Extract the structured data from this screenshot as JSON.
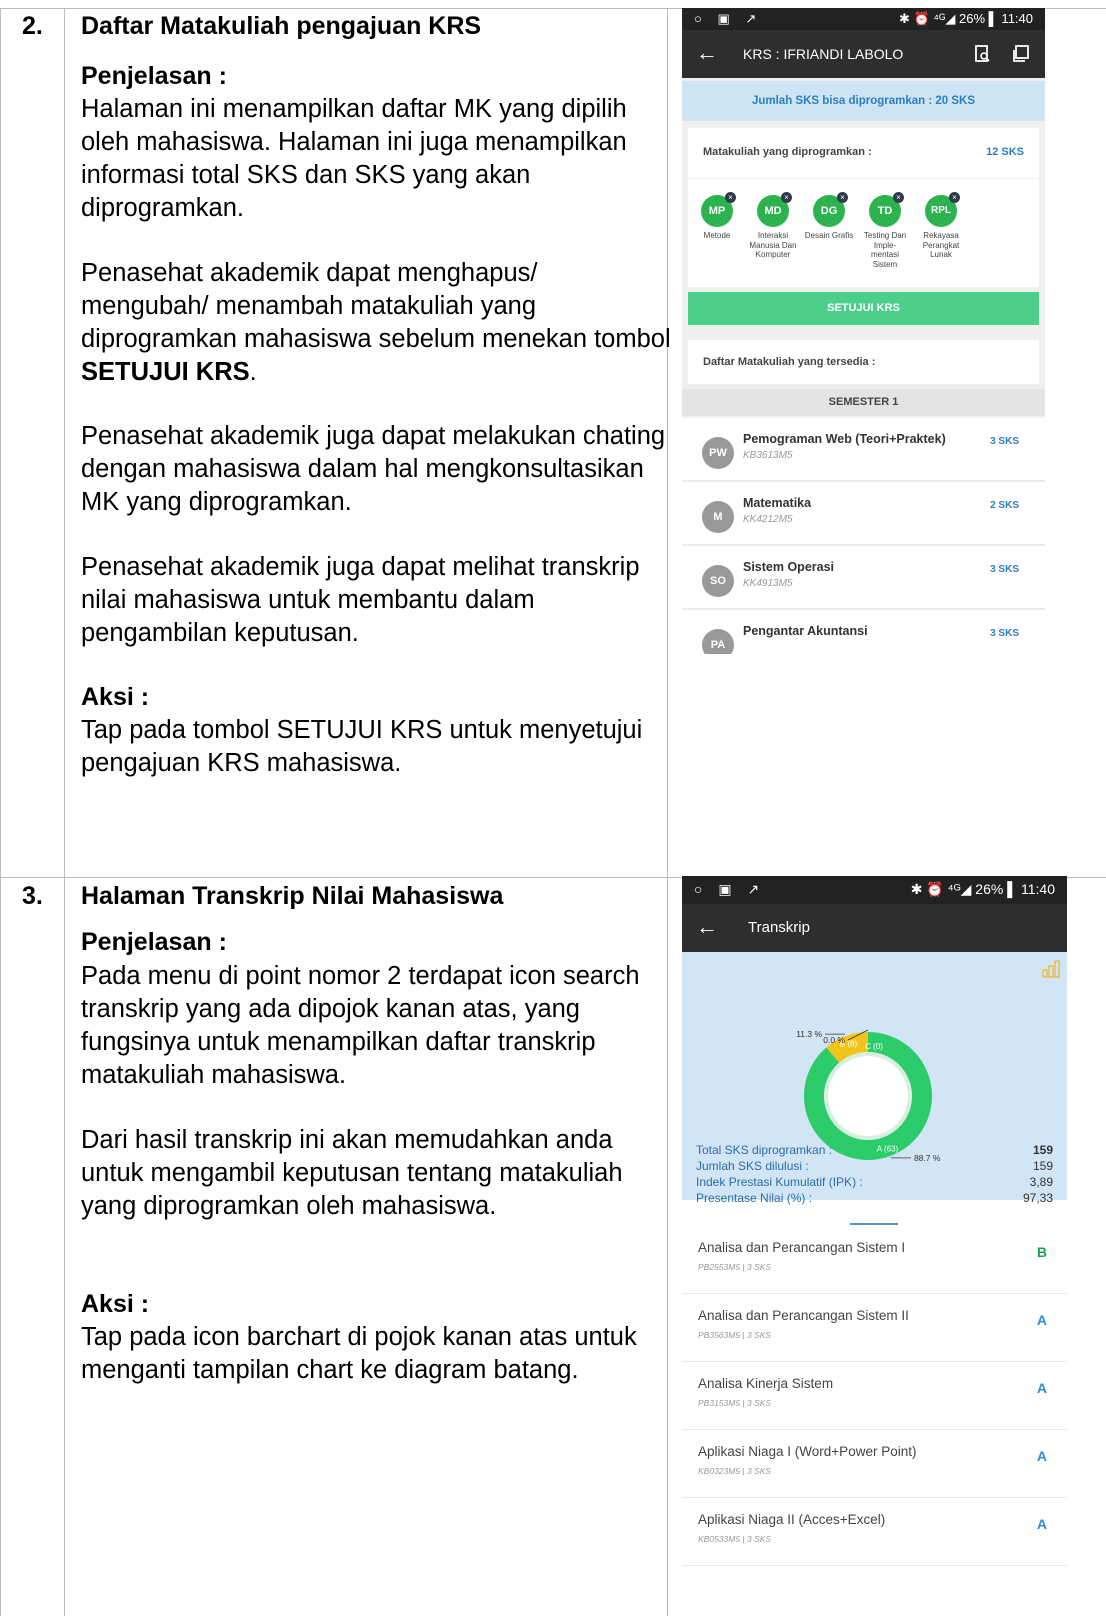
{
  "sections": [
    {
      "number": "2.",
      "heading": "Daftar Matakuliah pengajuan KRS",
      "explain_label": "Penjelasan :",
      "paragraphs": [
        "Halaman ini menampilkan daftar MK yang dipilih oleh mahasiswa. Halaman ini juga menampilkan informasi total SKS dan SKS yang akan diprogramkan.",
        "Penasehat akademik dapat menghapus/ mengubah/ menambah matakuliah yang diprogramkan mahasiswa sebelum menekan tombol ",
        "Penasehat akademik juga dapat melakukan chating dengan mahasiswa dalam hal mengkonsultasikan MK yang diprogramkan.",
        "Penasehat akademik juga dapat melihat transkrip nilai mahasiswa untuk membantu dalam pengambilan keputusan."
      ],
      "bold_term": "SETUJUI KRS",
      "bold_suffix": ".",
      "action_label": "Aksi :",
      "action_text": "Tap pada tombol SETUJUI KRS untuk menyetujui pengajuan KRS mahasiswa."
    },
    {
      "number": "3.",
      "heading": "Halaman Transkrip Nilai Mahasiswa",
      "explain_label": "Penjelasan :",
      "paragraphs": [
        "Pada menu di point nomor 2 terdapat icon search transkrip yang ada dipojok kanan atas, yang fungsinya untuk menampilkan daftar transkrip matakuliah mahasiswa.",
        "Dari hasil transkrip ini akan memudahkan anda untuk mengambil keputusan tentang matakuliah yang diprogramkan oleh mahasiswa."
      ],
      "action_label": "Aksi :",
      "action_text": "Tap pada icon barchart di pojok kanan atas untuk menganti tampilan chart ke diagram batang."
    }
  ],
  "status_bar": {
    "left_icons": "○ ▣ ↗",
    "right": "✱ ⏰ ⁴ᴳ◢ 26% ▌ 11:40"
  },
  "krs_screen": {
    "title": "KRS : IFRIANDI LABOLO",
    "icons": [
      "transcript-search-icon",
      "chat-icon"
    ],
    "banner": "Jumlah SKS bisa diprogramkan : 20 SKS",
    "selected_label": "Matakuliah yang diprogramkan :",
    "selected_sks": "12 SKS",
    "selected": [
      {
        "abbr": "MP",
        "name": "Metode"
      },
      {
        "abbr": "MD",
        "name": "Interaksi Manusia Dan Komputer"
      },
      {
        "abbr": "DG",
        "name": "Desain Grafis"
      },
      {
        "abbr": "TD",
        "name": "Testing Dan Imple- mentasi Sistem"
      },
      {
        "abbr": "RPL",
        "name": "Rekayasa Perangkat Lunak"
      }
    ],
    "remove_glyph": "×",
    "approve_button": "SETUJUI KRS",
    "available_label": "Daftar Matakuliah yang tersedia :",
    "semester": "SEMESTER 1",
    "courses": [
      {
        "abbr": "PW",
        "name": "Pemograman Web (Teori+Praktek)",
        "code": "KB3613M5",
        "sks": "3 SKS"
      },
      {
        "abbr": "M",
        "name": "Matematika",
        "code": "KK4212M5",
        "sks": "2 SKS"
      },
      {
        "abbr": "SO",
        "name": "Sistem Operasi",
        "code": "KK4913M5",
        "sks": "3 SKS"
      },
      {
        "abbr": "PA",
        "name": "Pengantar Akuntansi",
        "code": "",
        "sks": "3 SKS"
      }
    ]
  },
  "transkrip_screen": {
    "title": "Transkrip",
    "chart_toggle_icon": "bar-chart-icon",
    "donut": [
      {
        "label": "A (63)",
        "percent_label": "88.7 %",
        "value": 88.7,
        "color": "#2dcc6b"
      },
      {
        "label": "B (8)",
        "percent_label": "11.3 %",
        "value": 11.3,
        "color": "#f0c419"
      },
      {
        "label": "C (0)",
        "percent_label": "0.0 %",
        "value": 0.0,
        "color": "#e74c3c"
      }
    ],
    "stats": [
      {
        "label": "Total SKS diprogramkan :",
        "value": "159"
      },
      {
        "label": "Jumlah SKS dilulusi :",
        "value": "159"
      },
      {
        "label": "Indek Prestasi Kumulatif (IPK) :",
        "value": "3,89"
      },
      {
        "label": "Presentase Nilai (%) :",
        "value": "97,33"
      }
    ],
    "rows": [
      {
        "name": "Analisa dan Perancangan Sistem I",
        "code": "PB2553M5 | 3 SKS",
        "grade": "B",
        "grade_color": "#1f9d55"
      },
      {
        "name": "Analisa dan Perancangan Sistem II",
        "code": "PB3563M5 | 3 SKS",
        "grade": "A",
        "grade_color": "#2b8fd6"
      },
      {
        "name": "Analisa Kinerja Sistem",
        "code": "PB3153M5 | 3 SKS",
        "grade": "A",
        "grade_color": "#2b8fd6"
      },
      {
        "name": "Aplikasi Niaga I (Word+Power Point)",
        "code": "KB0323M5 | 3 SKS",
        "grade": "A",
        "grade_color": "#2b8fd6"
      },
      {
        "name": "Aplikasi Niaga II (Acces+Excel)",
        "code": "KB0533M5 | 3 SKS",
        "grade": "A",
        "grade_color": "#2b8fd6"
      }
    ]
  }
}
